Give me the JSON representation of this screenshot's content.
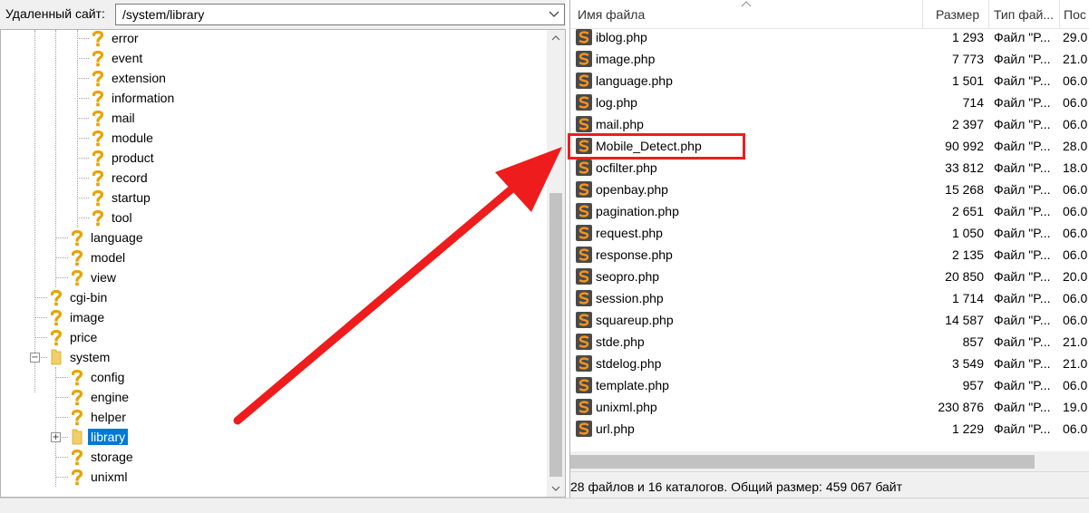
{
  "left_pane": {
    "path_label": "Удаленный сайт:",
    "path_value": "/system/library",
    "tree": [
      {
        "label": "error",
        "icon": "question-icon",
        "level": 3
      },
      {
        "label": "event",
        "icon": "question-icon",
        "level": 3
      },
      {
        "label": "extension",
        "icon": "question-icon",
        "level": 3
      },
      {
        "label": "information",
        "icon": "question-icon",
        "level": 3
      },
      {
        "label": "mail",
        "icon": "question-icon",
        "level": 3
      },
      {
        "label": "module",
        "icon": "question-icon",
        "level": 3
      },
      {
        "label": "product",
        "icon": "question-icon",
        "level": 3
      },
      {
        "label": "record",
        "icon": "question-icon",
        "level": 3
      },
      {
        "label": "startup",
        "icon": "question-icon",
        "level": 3
      },
      {
        "label": "tool",
        "icon": "question-icon",
        "level": 3
      },
      {
        "label": "language",
        "icon": "question-icon",
        "level": 2
      },
      {
        "label": "model",
        "icon": "question-icon",
        "level": 2
      },
      {
        "label": "view",
        "icon": "question-icon",
        "level": 2
      },
      {
        "label": "cgi-bin",
        "icon": "question-icon",
        "level": 1
      },
      {
        "label": "image",
        "icon": "question-icon",
        "level": 1
      },
      {
        "label": "price",
        "icon": "question-icon",
        "level": 1
      },
      {
        "label": "system",
        "icon": "folder-icon",
        "level": 1,
        "expanded": true
      },
      {
        "label": "config",
        "icon": "question-icon",
        "level": 2
      },
      {
        "label": "engine",
        "icon": "question-icon",
        "level": 2
      },
      {
        "label": "helper",
        "icon": "question-icon",
        "level": 2
      },
      {
        "label": "library",
        "icon": "folder-icon",
        "level": 2,
        "selected": true,
        "collapsed": true
      },
      {
        "label": "storage",
        "icon": "question-icon",
        "level": 2
      },
      {
        "label": "unixml",
        "icon": "question-icon",
        "level": 2
      }
    ]
  },
  "right_pane": {
    "columns": {
      "name": "Имя файла",
      "size": "Размер",
      "type": "Тип фай...",
      "date": "Пос"
    },
    "files": [
      {
        "name": "iblog.php",
        "size": "1 293",
        "type": "Файл \"P...",
        "date": "29.0"
      },
      {
        "name": "image.php",
        "size": "7 773",
        "type": "Файл \"P...",
        "date": "21.0"
      },
      {
        "name": "language.php",
        "size": "1 501",
        "type": "Файл \"P...",
        "date": "06.0"
      },
      {
        "name": "log.php",
        "size": "714",
        "type": "Файл \"P...",
        "date": "06.0"
      },
      {
        "name": "mail.php",
        "size": "2 397",
        "type": "Файл \"P...",
        "date": "06.0"
      },
      {
        "name": "Mobile_Detect.php",
        "size": "90 992",
        "type": "Файл \"P...",
        "date": "28.0",
        "highlighted": true
      },
      {
        "name": "ocfilter.php",
        "size": "33 812",
        "type": "Файл \"P...",
        "date": "18.0"
      },
      {
        "name": "openbay.php",
        "size": "15 268",
        "type": "Файл \"P...",
        "date": "06.0"
      },
      {
        "name": "pagination.php",
        "size": "2 651",
        "type": "Файл \"P...",
        "date": "06.0"
      },
      {
        "name": "request.php",
        "size": "1 050",
        "type": "Файл \"P...",
        "date": "06.0"
      },
      {
        "name": "response.php",
        "size": "2 135",
        "type": "Файл \"P...",
        "date": "06.0"
      },
      {
        "name": "seopro.php",
        "size": "20 850",
        "type": "Файл \"P...",
        "date": "20.0"
      },
      {
        "name": "session.php",
        "size": "1 714",
        "type": "Файл \"P...",
        "date": "06.0"
      },
      {
        "name": "squareup.php",
        "size": "14 587",
        "type": "Файл \"P...",
        "date": "06.0"
      },
      {
        "name": "stde.php",
        "size": "857",
        "type": "Файл \"P...",
        "date": "21.0"
      },
      {
        "name": "stdelog.php",
        "size": "3 549",
        "type": "Файл \"P...",
        "date": "21.0"
      },
      {
        "name": "template.php",
        "size": "957",
        "type": "Файл \"P...",
        "date": "06.0"
      },
      {
        "name": "unixml.php",
        "size": "230 876",
        "type": "Файл \"P...",
        "date": "19.0"
      },
      {
        "name": "url.php",
        "size": "1 229",
        "type": "Файл \"P...",
        "date": "06.0"
      }
    ],
    "status": "28 файлов и 16 каталогов. Общий размер: 459 067 байт"
  },
  "colors": {
    "selection": "#0078d7",
    "annotation_red": "#ee1c1c",
    "php_icon_bg": "#4a4a4a",
    "php_icon_fg": "#f7941d",
    "question_icon": "#e8a200"
  }
}
